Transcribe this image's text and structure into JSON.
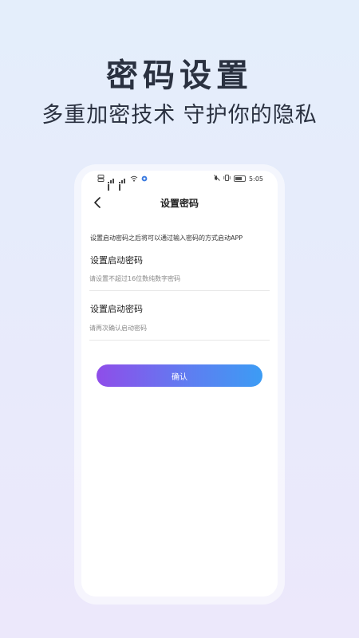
{
  "hero": {
    "title": "密码设置",
    "subtitle": "多重加密技术 守护你的隐私"
  },
  "status_bar": {
    "left_indicators": [
      "sim-icon",
      "signal-icon",
      "signal-icon",
      "wifi-icon",
      "sync-icon"
    ],
    "right_indicators": [
      "mute-icon",
      "vibrate-icon",
      "battery-icon"
    ],
    "time": "5:05"
  },
  "nav": {
    "title": "设置密码",
    "back_icon": "chevron-left-icon"
  },
  "form": {
    "hint": "设置启动密码之后将可以通过输入密码的方式启动APP",
    "field1": {
      "label": "设置启动密码",
      "placeholder": "请设置不超过16位数纯数字密码",
      "value": ""
    },
    "field2": {
      "label": "设置启动密码",
      "placeholder": "请再次确认启动密码",
      "value": ""
    },
    "confirm_label": "确认"
  },
  "colors": {
    "button_gradient_start": "#8f4de9",
    "button_gradient_end": "#3c9cf4",
    "title_color": "#2a3140"
  }
}
